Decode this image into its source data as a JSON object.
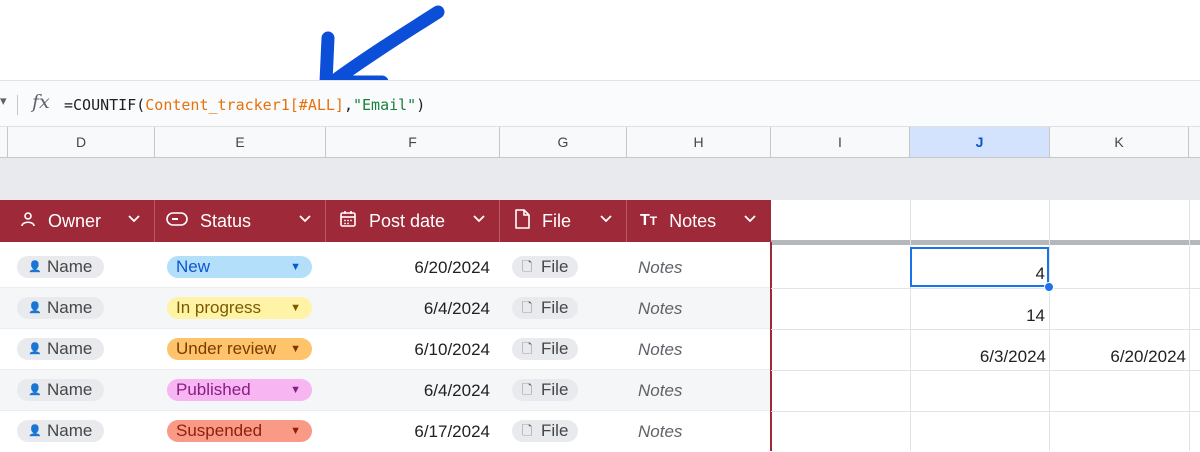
{
  "formula_bar": {
    "formula_prefix": "=COUNTIF(",
    "formula_range": "Content_tracker1[#ALL]",
    "formula_comma": ",",
    "formula_string": "\"Email\"",
    "formula_close": ")",
    "fx_label": "fx"
  },
  "columns": [
    "D",
    "E",
    "F",
    "G",
    "H",
    "I",
    "J",
    "K"
  ],
  "selected_column": "J",
  "table": {
    "header_color": "#9e2a39",
    "headers": [
      {
        "label": "Owner",
        "icon": "person-icon"
      },
      {
        "label": "Status",
        "icon": "toggle-chip-icon"
      },
      {
        "label": "Post date",
        "icon": "calendar-icon"
      },
      {
        "label": "File",
        "icon": "file-icon"
      },
      {
        "label": "Notes",
        "icon": "text-format-icon"
      }
    ],
    "rows": [
      {
        "owner": "Name",
        "status": "New",
        "status_bg": "#b3dffb",
        "status_fg": "#0b57d0",
        "date": "6/20/2024",
        "file": "File",
        "notes": "Notes"
      },
      {
        "owner": "Name",
        "status": "In progress",
        "status_bg": "#fff3a6",
        "status_fg": "#7a5b00",
        "date": "6/4/2024",
        "file": "File",
        "notes": "Notes"
      },
      {
        "owner": "Name",
        "status": "Under review",
        "status_bg": "#ffc46b",
        "status_fg": "#7a3a00",
        "date": "6/10/2024",
        "file": "File",
        "notes": "Notes"
      },
      {
        "owner": "Name",
        "status": "Published",
        "status_bg": "#f7b5f2",
        "status_fg": "#8a1c86",
        "date": "6/4/2024",
        "file": "File",
        "notes": "Notes"
      },
      {
        "owner": "Name",
        "status": "Suspended",
        "status_bg": "#f99a86",
        "status_fg": "#8f1e0c",
        "date": "6/17/2024",
        "file": "File",
        "notes": "Notes"
      }
    ]
  },
  "cells": {
    "j_row1": "4",
    "j_row2": "14",
    "j_row3": "6/3/2024",
    "k_row3": "6/20/2024"
  },
  "annotation": {
    "arrow_color": "#0b4fd8"
  }
}
